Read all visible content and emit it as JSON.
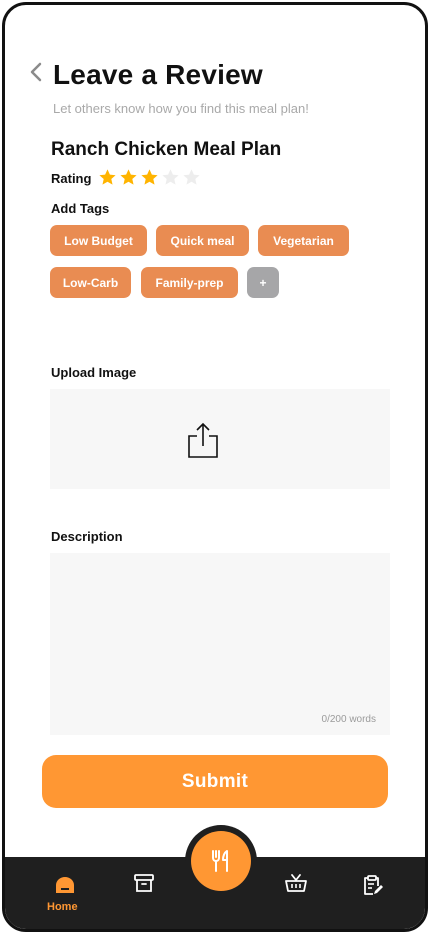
{
  "header": {
    "title": "Leave a Review",
    "subtitle": "Let others know how you find this meal plan!"
  },
  "plan": {
    "name": "Ranch Chicken Meal Plan"
  },
  "rating": {
    "label": "Rating",
    "value": 3,
    "max": 5,
    "filled_color": "#FFB400",
    "empty_color": "#EDEDED"
  },
  "tags": {
    "label": "Add Tags",
    "items": [
      "Low Budget",
      "Quick meal",
      "Vegetarian",
      "Low-Carb",
      "Family-prep"
    ],
    "add_label": "+",
    "color": "#E98C52"
  },
  "upload": {
    "label": "Upload Image",
    "icon": "share-upload-icon"
  },
  "description": {
    "label": "Description",
    "counter": "0/200 words"
  },
  "submit": {
    "label": "Submit",
    "color": "#FF9733"
  },
  "nav": {
    "home_label": "Home",
    "items": [
      "home-icon",
      "archive-icon",
      "fork-knife-icon",
      "basket-icon",
      "clipboard-edit-icon"
    ],
    "active": "Home"
  }
}
